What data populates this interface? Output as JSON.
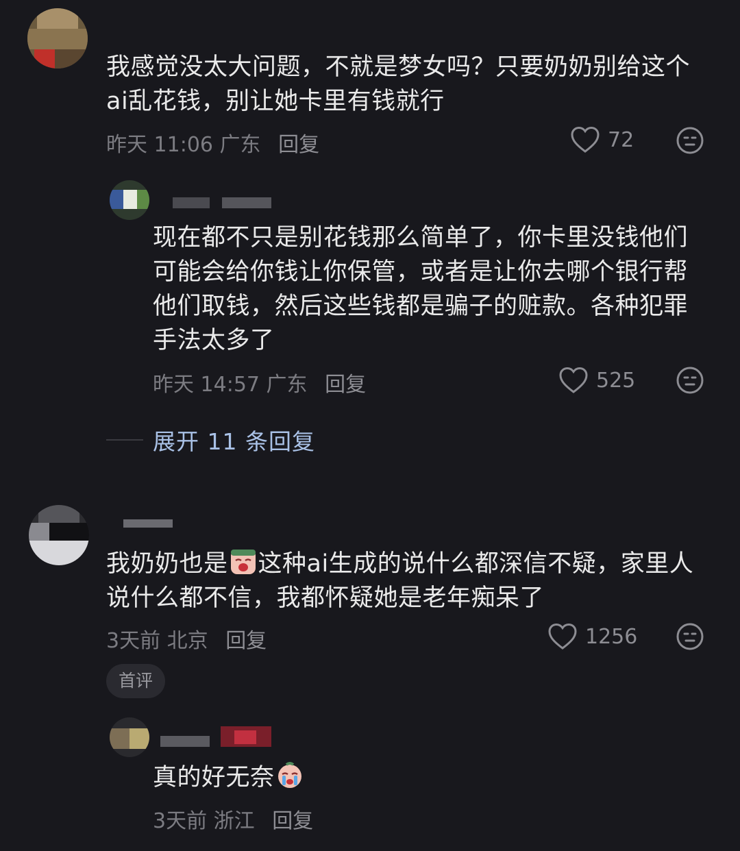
{
  "comments": [
    {
      "text": "我感觉没太大问题，不就是梦女吗？只要奶奶别给这个ai乱花钱，别让她卡里有钱就行",
      "time": "昨天 11:06",
      "location": "广东",
      "reply_label": "回复",
      "likes": "72"
    },
    {
      "text": "现在都不只是别花钱那么简单了，你卡里没钱他们可能会给你钱让你保管，或者是让你去哪个银行帮他们取钱，然后这些钱都是骗子的赃款。各种犯罪手法太多了",
      "time": "昨天 14:57",
      "location": "广东",
      "reply_label": "回复",
      "likes": "525"
    },
    {
      "text_before_emoji": "我奶奶也是",
      "text_after_emoji": "这种ai生成的说什么都深信不疑，家里人说什么都不信，我都怀疑她是老年痴呆了",
      "time": "3天前",
      "location": "北京",
      "reply_label": "回复",
      "likes": "1256",
      "badge": "首评"
    },
    {
      "text": "真的好无奈",
      "time": "3天前",
      "location": "浙江",
      "reply_label": "回复"
    }
  ],
  "expand_replies": "展开 11 条回复",
  "icons": {
    "like": "heart-outline-icon",
    "react": "emoji-face-icon",
    "emoji_crying": "crying-face-emoji"
  },
  "colors": {
    "background": "#18181d",
    "text": "#eaeaea",
    "meta": "#7c7c82",
    "link": "#a9c1e6"
  }
}
